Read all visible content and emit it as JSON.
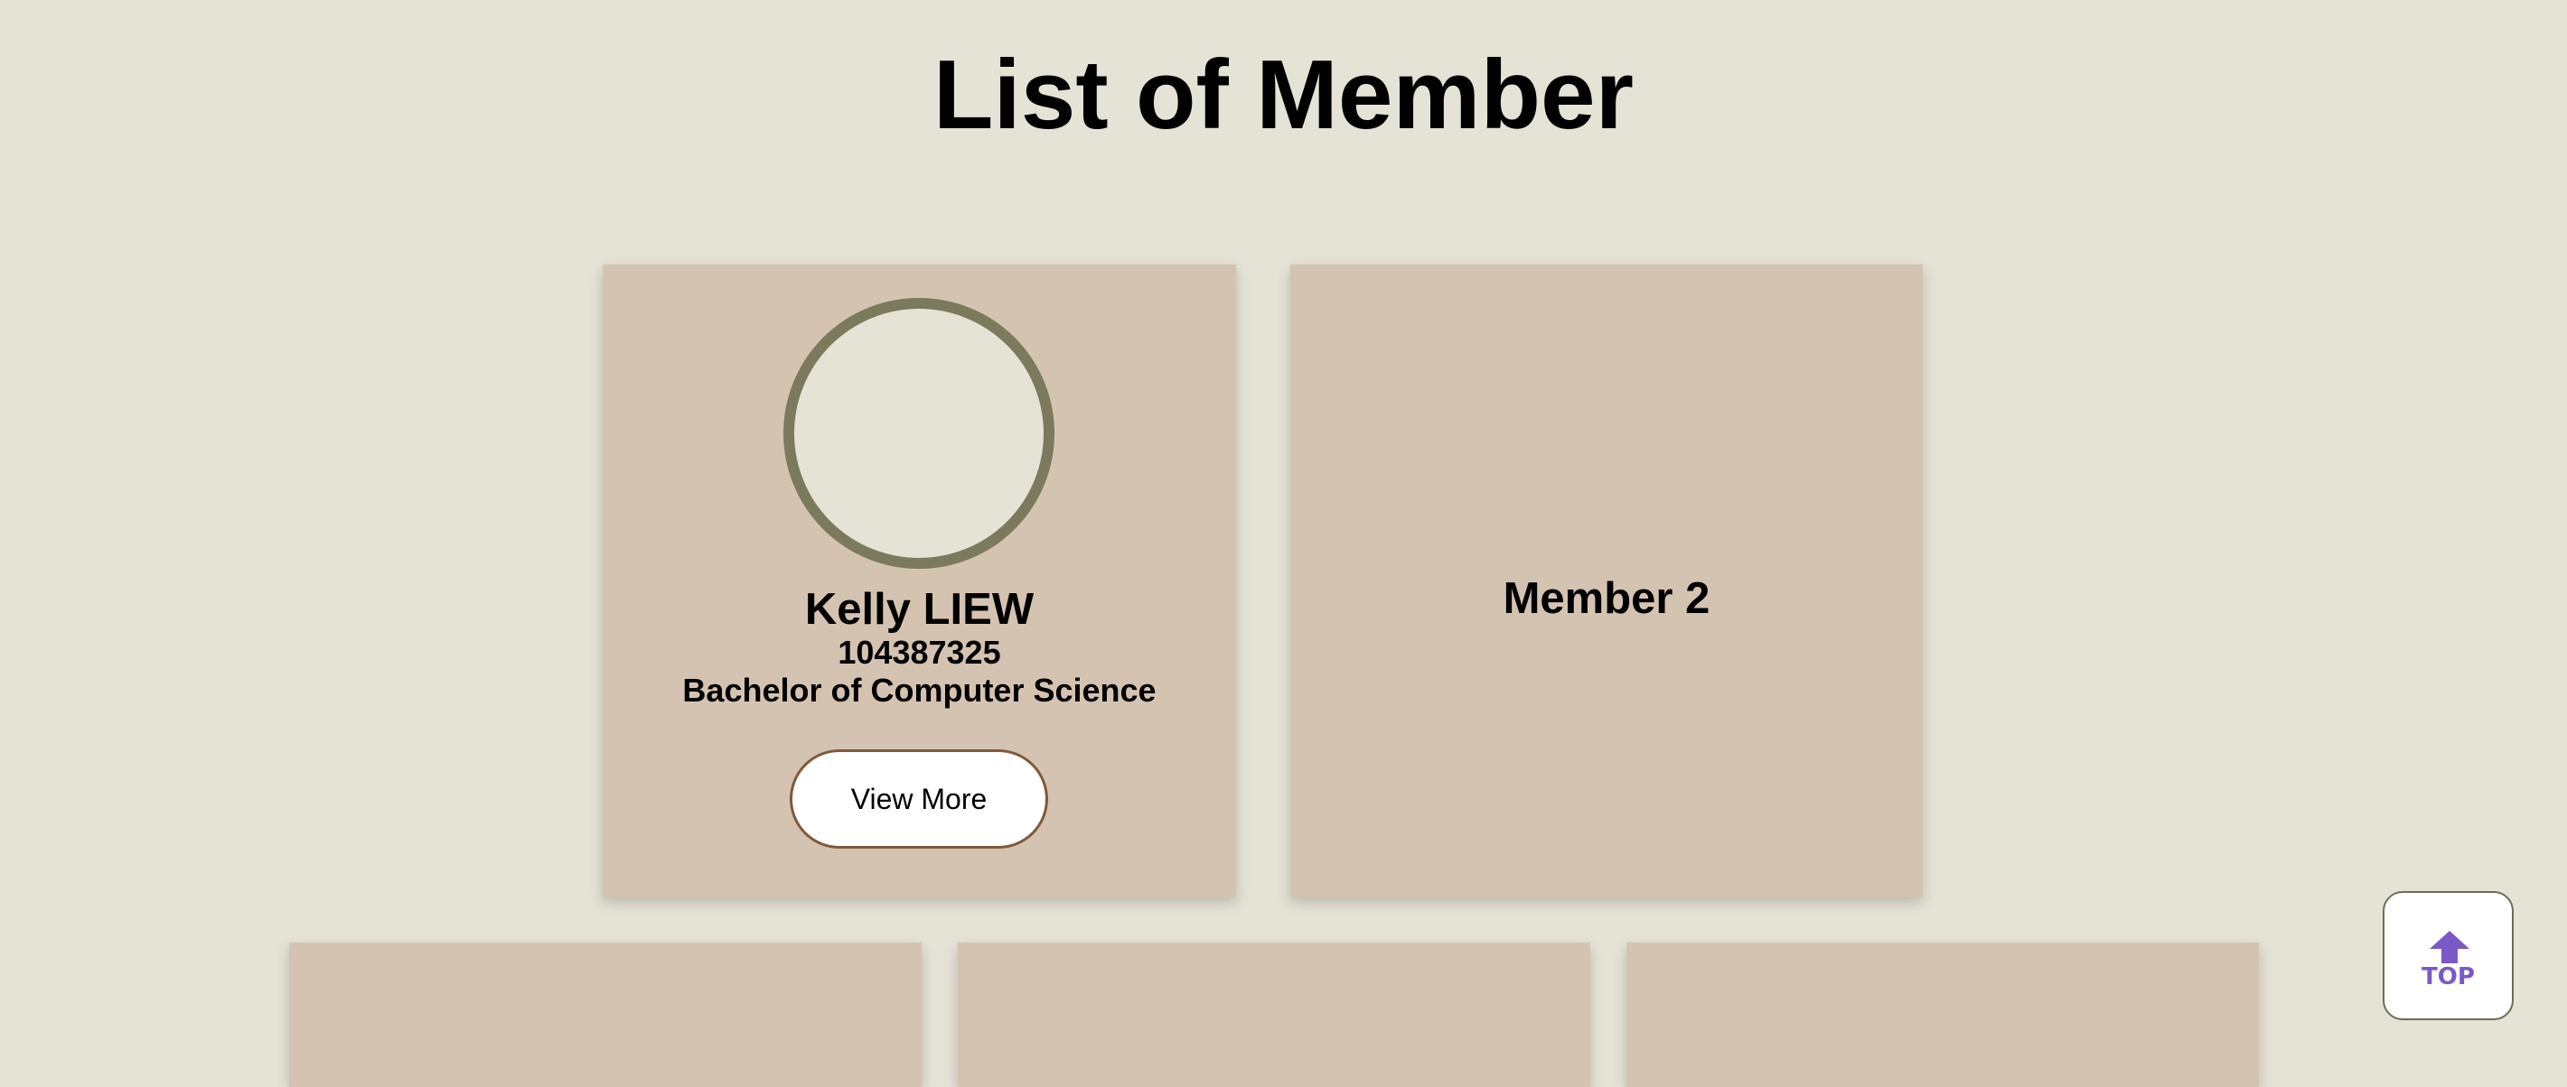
{
  "page": {
    "title": "List of Member"
  },
  "members": [
    {
      "name": "Kelly LIEW",
      "id": "104387325",
      "course": "Bachelor of Computer Science",
      "button_label": "View More"
    },
    {
      "label": "Member 2"
    }
  ],
  "top_button": {
    "label": "TOP",
    "icon": "arrow-up-icon"
  },
  "colors": {
    "background": "#e5e2d6",
    "card": "#d5c3b1",
    "avatar_border": "#7b7a5d",
    "button_border": "#7d5a3c",
    "top_accent": "#7b59c4"
  }
}
